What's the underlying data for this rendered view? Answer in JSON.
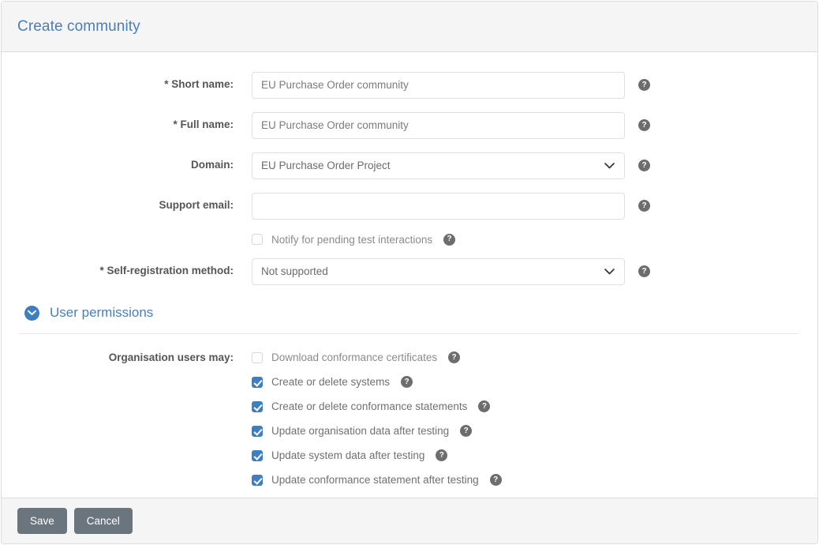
{
  "panel": {
    "title": "Create community"
  },
  "form": {
    "fields": [
      {
        "label": "* Short name:",
        "type": "text",
        "value": "EU Purchase Order community",
        "placeholder": "EU Purchase Order community",
        "help_icon": "help-icon"
      },
      {
        "label": "* Full name:",
        "type": "text",
        "value": "EU Purchase Order community",
        "placeholder": "EU Purchase Order community",
        "help_icon": "help-icon"
      },
      {
        "label": "Domain:",
        "type": "select",
        "value": "EU Purchase Order Project",
        "options": [
          "EU Purchase Order Project"
        ],
        "chevron_icon": "chevron-down-icon",
        "help_icon": "help-icon"
      },
      {
        "label": "Support email:",
        "type": "text",
        "value": "",
        "placeholder": "",
        "help_icon": "help-icon"
      }
    ],
    "notify_checkbox": {
      "label": "Notify for pending test interactions",
      "checked": false,
      "help_icon": "help-icon"
    },
    "self_registration": {
      "label": "* Self-registration method:",
      "value": "Not supported",
      "options": [
        "Not supported"
      ],
      "chevron_icon": "chevron-down-icon",
      "help_icon": "help-icon"
    }
  },
  "user_permissions": {
    "title": "User permissions",
    "collapse_icon": "chevron-down-circle-icon",
    "org_users_label": "Organisation users may:",
    "permissions": [
      {
        "label": "Download conformance certificates",
        "checked": false,
        "help_icon": "help-icon"
      },
      {
        "label": "Create or delete systems",
        "checked": true,
        "help_icon": "help-icon"
      },
      {
        "label": "Create or delete conformance statements",
        "checked": true,
        "help_icon": "help-icon"
      },
      {
        "label": "Update organisation data after testing",
        "checked": true,
        "help_icon": "help-icon"
      },
      {
        "label": "Update system data after testing",
        "checked": true,
        "help_icon": "help-icon"
      },
      {
        "label": "Update conformance statement after testing",
        "checked": true,
        "help_icon": "help-icon"
      }
    ]
  },
  "footer": {
    "save_label": "Save",
    "cancel_label": "Cancel"
  },
  "colors": {
    "accent_blue": "#4a7ebb",
    "checkbox_blue": "#3f7fc1",
    "button_gray": "#6b757d",
    "header_gray": "#f5f5f5",
    "border_gray": "#dddddd"
  }
}
